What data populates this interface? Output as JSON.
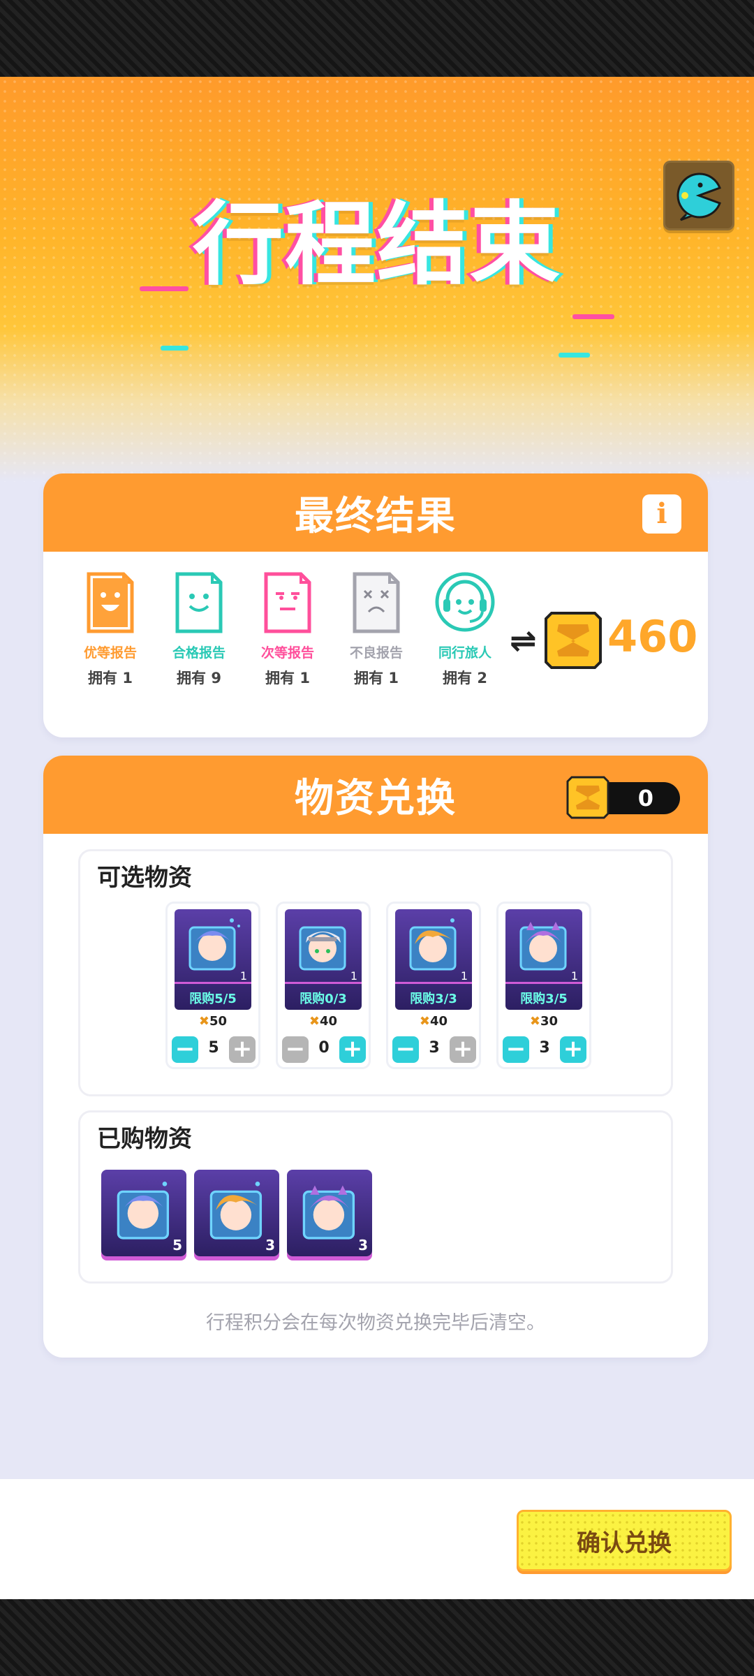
{
  "header": {
    "title": "行程结束"
  },
  "result_card": {
    "title": "最终结果",
    "info_label": "i",
    "reports": [
      {
        "label": "优等报告",
        "count": "拥有 1",
        "color": "#ff9b30",
        "icon": "happy-report-icon"
      },
      {
        "label": "合格报告",
        "count": "拥有 9",
        "color": "#2ac9b5",
        "icon": "smile-report-icon"
      },
      {
        "label": "次等报告",
        "count": "拥有 1",
        "color": "#ff4f9b",
        "icon": "meh-report-icon"
      },
      {
        "label": "不良报告",
        "count": "拥有 1",
        "color": "#a3a3ad",
        "icon": "bad-report-icon"
      },
      {
        "label": "同行旅人",
        "count": "拥有 2",
        "color": "#2ac9b5",
        "icon": "headset-icon"
      }
    ],
    "exchange_symbol": "⇌",
    "coin_total": "460"
  },
  "exchange_card": {
    "title": "物资兑换",
    "coin_balance": "0",
    "available": {
      "title": "可选物资",
      "items": [
        {
          "limit": "限购5/5",
          "qty": "1",
          "price": "50",
          "amount": "5",
          "minus_active": true,
          "plus_active": false,
          "hair": "#7a8cf0"
        },
        {
          "limit": "限购0/3",
          "qty": "1",
          "price": "40",
          "amount": "0",
          "minus_active": false,
          "plus_active": true,
          "hair": "#e8e8f0"
        },
        {
          "limit": "限购3/3",
          "qty": "1",
          "price": "40",
          "amount": "3",
          "minus_active": true,
          "plus_active": false,
          "hair": "#f2a83a"
        },
        {
          "limit": "限购3/5",
          "qty": "1",
          "price": "30",
          "amount": "3",
          "minus_active": true,
          "plus_active": true,
          "hair": "#b06fe0"
        }
      ]
    },
    "purchased": {
      "title": "已购物资",
      "items": [
        {
          "qty": "5",
          "hair": "#7a8cf0"
        },
        {
          "qty": "3",
          "hair": "#f2a83a"
        },
        {
          "qty": "3",
          "hair": "#b06fe0"
        }
      ]
    },
    "footnote": "行程积分会在每次物资兑换完毕后清空。"
  },
  "confirm_label": "确认兑换"
}
